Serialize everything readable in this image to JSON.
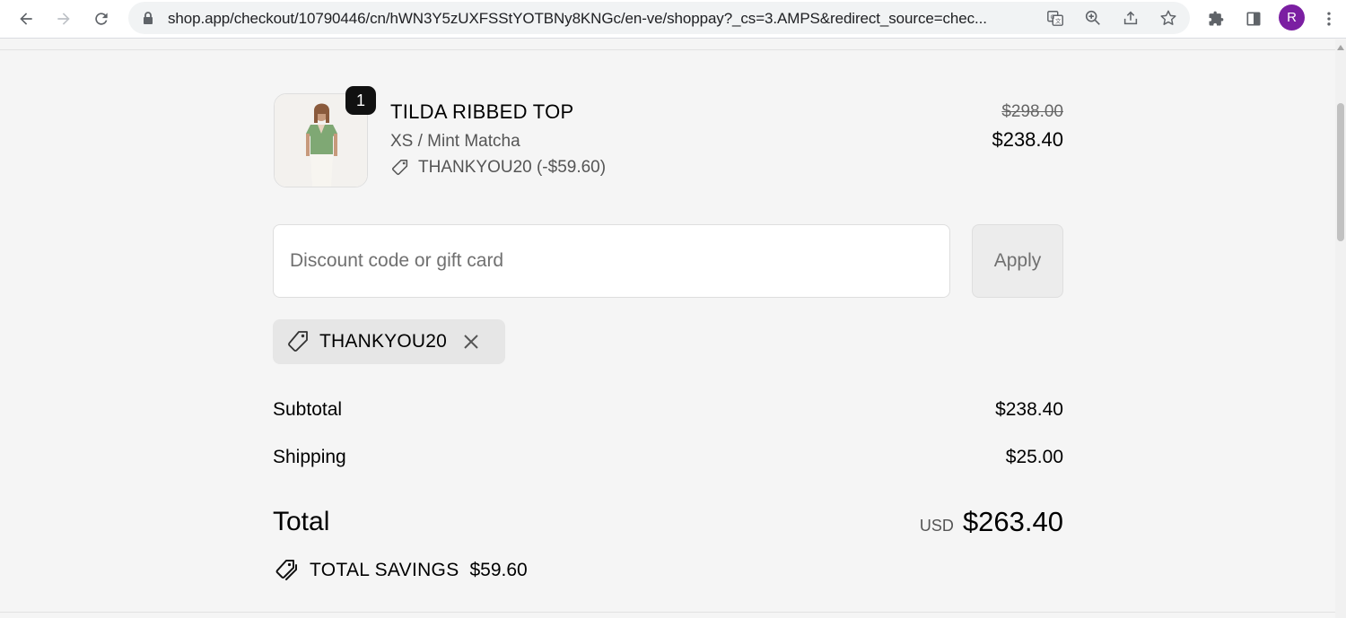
{
  "browser": {
    "url": "shop.app/checkout/10790446/cn/hWN3Y5zUXFSStYOTBNy8KNGc/en-ve/shoppay?_cs=3.AMPS&redirect_source=chec...",
    "profile_initial": "R",
    "profile_color": "#7b1fa2"
  },
  "product": {
    "quantity": "1",
    "name": "TILDA RIBBED TOP",
    "variant": "XS / Mint Matcha",
    "discount_line": "THANKYOU20 (-$59.60)",
    "original_price": "$298.00",
    "price": "$238.40"
  },
  "discount": {
    "placeholder": "Discount code or gift card",
    "apply_label": "Apply",
    "applied_code": "THANKYOU20"
  },
  "summary": {
    "subtotal_label": "Subtotal",
    "subtotal_value": "$238.40",
    "shipping_label": "Shipping",
    "shipping_value": "$25.00",
    "total_label": "Total",
    "currency": "USD",
    "total_value": "$263.40",
    "savings_label": "TOTAL SAVINGS",
    "savings_value": "$59.60"
  }
}
